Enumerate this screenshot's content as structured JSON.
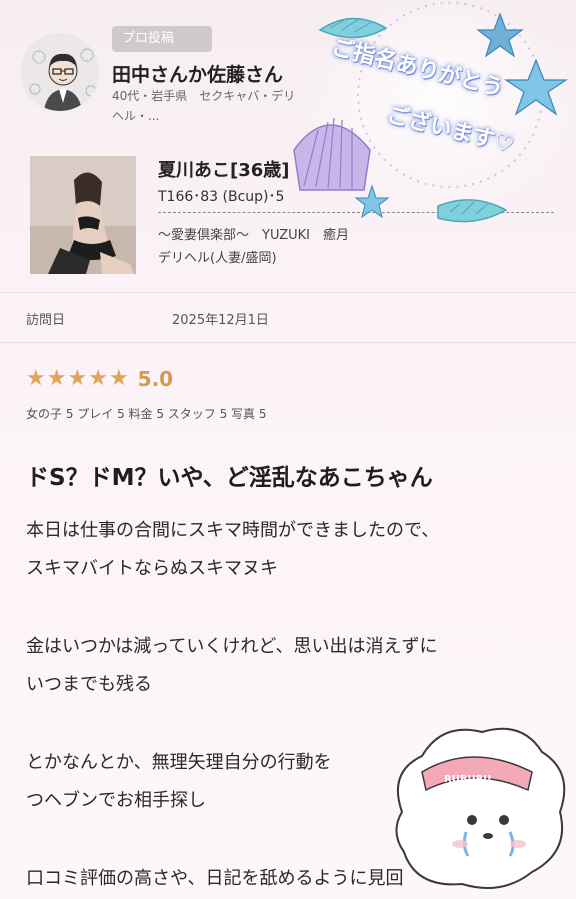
{
  "reviewer": {
    "badge": "プロ投稿",
    "name": "田中さんか佐藤さん",
    "meta_line1": "40代・岩手県　セクキャバ・デリ",
    "meta_line2": "ヘル・..."
  },
  "girl": {
    "name": "夏川あこ[36歳]",
    "size": "T166･83 (Bcup)･5",
    "shop": "〜愛妻倶楽部〜　YUZUKI　癒月",
    "genre": "デリヘル(人妻/盛岡)"
  },
  "visit": {
    "label": "訪問日",
    "date": "2025年12月1日"
  },
  "rating": {
    "stars": 5,
    "score": "5.0",
    "subscores": "女の子 5  プレイ 5  料金 5  スタッフ 5  写真 5"
  },
  "review": {
    "title": "ドS？ドM？いや、ど淫乱なあこちゃん",
    "lines": [
      "本日は仕事の合間にスキマ時間ができましたので、",
      "スキマバイトならぬスキマヌキ",
      "金はいつかは減っていくけれど、思い出は消えずに",
      "いつまでも残る",
      "とかなんとか、無理矢理自分の行動を",
      "つヘブンでお相手探し",
      "口コミ評価の高さや、日記を舐めるように見回"
    ]
  },
  "stamp": {
    "line1": "ご指名ありがとう",
    "line2": "ございます♡",
    "icon": "seashell-starfish-stamp"
  },
  "sticker": {
    "icon": "crying-dog-sticker",
    "text": "RUBUBU"
  },
  "colors": {
    "star": "#e0a45a",
    "score": "#d69a4f",
    "background": "#f8eef3"
  }
}
